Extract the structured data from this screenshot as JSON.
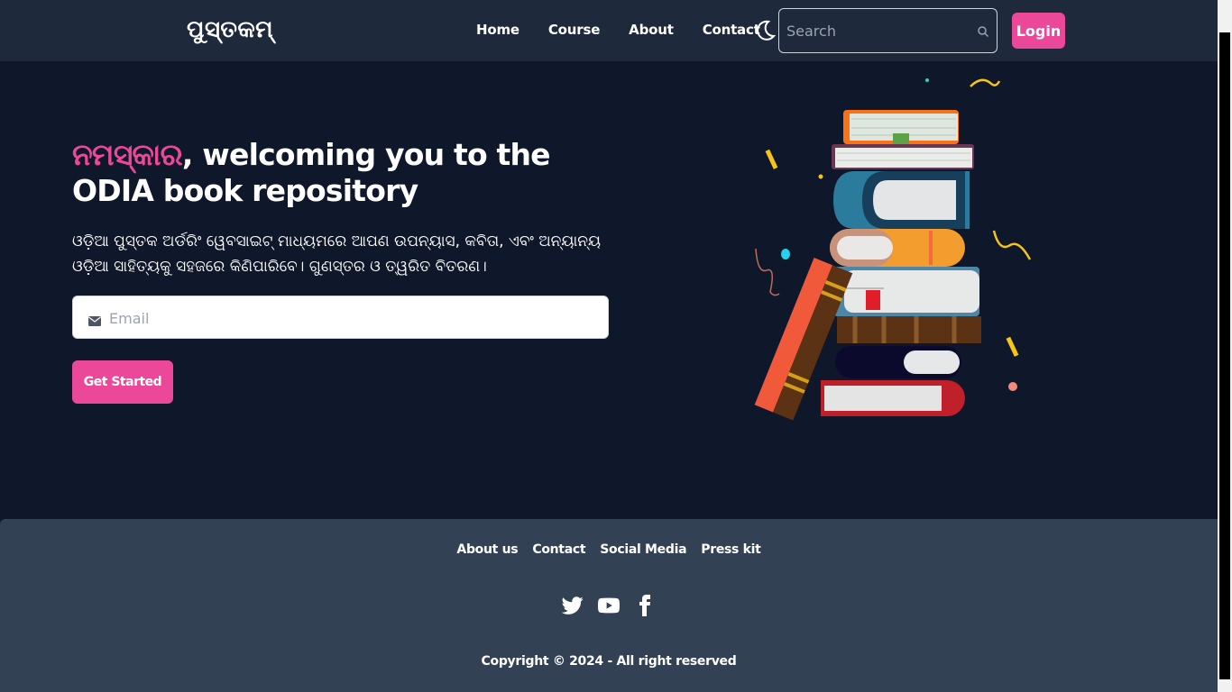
{
  "brand": {
    "logo_text": "ପୁସ୍ତକମ୍"
  },
  "nav": {
    "links": [
      "Home",
      "Course",
      "About",
      "Contact"
    ],
    "search_placeholder": "Search",
    "login_label": "Login"
  },
  "hero": {
    "title_accent": "ନମସ୍କାର",
    "title_rest": ", welcoming you to the ODIA book repository",
    "description": "ଓଡ଼ିଆ ପୁସ୍ତକ ଅର୍ଡରିଂ ୱେବସାଇଟ୍ ମାଧ୍ୟମରେ ଆପଣ ଉପନ୍ୟାସ, କବିତା, ଏବଂ ଅନ୍ୟାନ୍ୟ ଓଡ଼ିଆ ସାହିତ୍ୟକୁ ସହଜରେ କିଣିପାରିବେ। ଗୁଣସ୍ତର ଓ ତ୍ୱରିତ ବିତରଣ।",
    "email_placeholder": "Email",
    "cta_label": "Get Started"
  },
  "footer": {
    "links": [
      "About us",
      "Contact",
      "Social Media",
      "Press kit"
    ],
    "social": [
      "twitter-icon",
      "youtube-icon",
      "facebook-icon"
    ],
    "copyright": "Copyright © 2024 - All right reserved"
  },
  "colors": {
    "accent": "#ec4899",
    "nav_bg": "#1e293b",
    "page_bg": "#0f172a",
    "footer_bg": "#334155"
  }
}
